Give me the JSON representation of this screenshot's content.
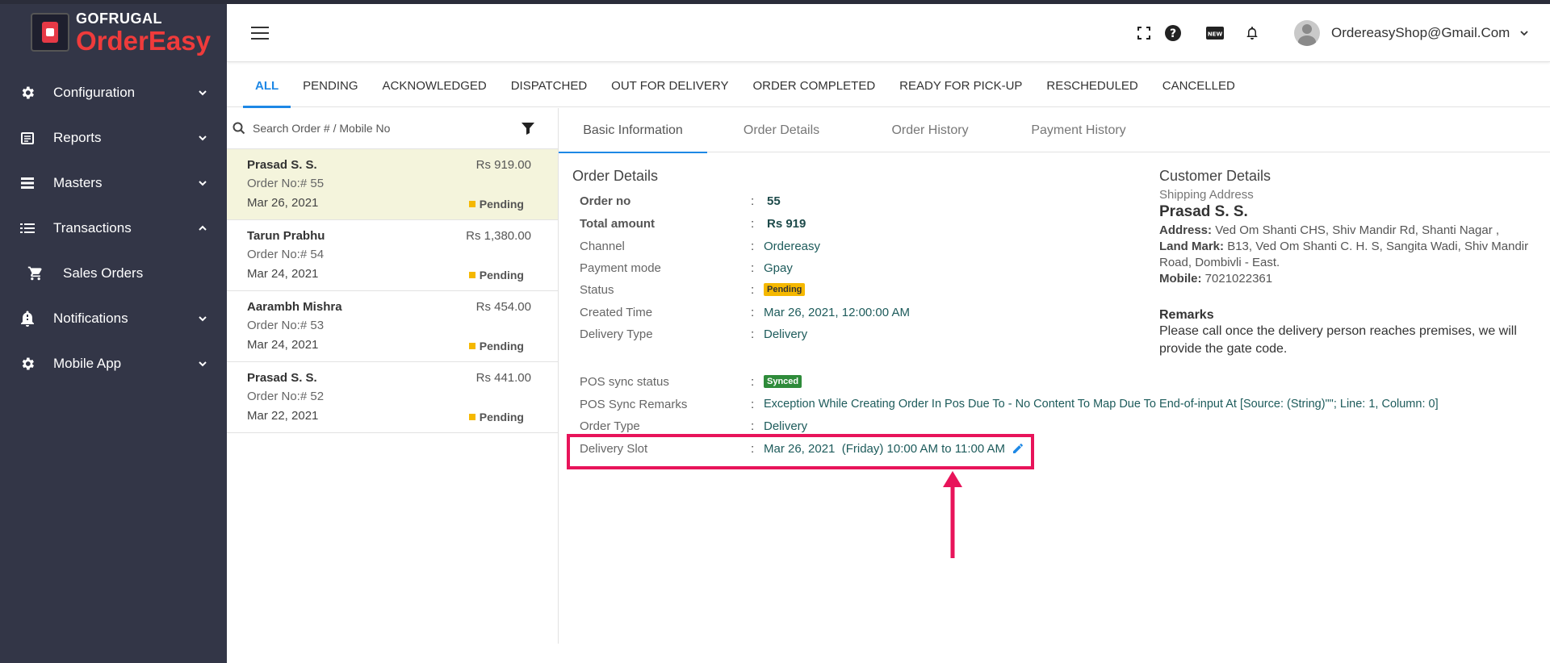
{
  "brand": {
    "top": "GOFRUGAL",
    "bottom": "OrderEasy"
  },
  "sidebar": {
    "items": [
      {
        "label": "Configuration",
        "icon": "gear-icon"
      },
      {
        "label": "Reports",
        "icon": "reports-icon"
      },
      {
        "label": "Masters",
        "icon": "masters-icon"
      },
      {
        "label": "Transactions",
        "icon": "list-icon"
      },
      {
        "label": "Sales Orders",
        "icon": "cart-icon"
      },
      {
        "label": "Notifications",
        "icon": "bell-alert-icon"
      },
      {
        "label": "Mobile App",
        "icon": "gear-icon"
      }
    ]
  },
  "header": {
    "user_email": "OrdereasyShop@Gmail.Com"
  },
  "status_tabs": [
    "ALL",
    "PENDING",
    "ACKNOWLEDGED",
    "DISPATCHED",
    "OUT FOR DELIVERY",
    "ORDER COMPLETED",
    "READY FOR PICK-UP",
    "RESCHEDULED",
    "CANCELLED"
  ],
  "search": {
    "placeholder": "Search Order # / Mobile No"
  },
  "orders": [
    {
      "name": "Prasad S. S.",
      "amount": "Rs 919.00",
      "order_no": "Order No:# 55",
      "date": "Mar 26, 2021",
      "status": "Pending"
    },
    {
      "name": "Tarun Prabhu",
      "amount": "Rs 1,380.00",
      "order_no": "Order No:# 54",
      "date": "Mar 24, 2021",
      "status": "Pending"
    },
    {
      "name": "Aarambh Mishra",
      "amount": "Rs 454.00",
      "order_no": "Order No:# 53",
      "date": "Mar 24, 2021",
      "status": "Pending"
    },
    {
      "name": "Prasad S. S.",
      "amount": "Rs 441.00",
      "order_no": "Order No:# 52",
      "date": "Mar 22, 2021",
      "status": "Pending"
    }
  ],
  "detail_tabs": [
    "Basic Information",
    "Order Details",
    "Order History",
    "Payment History"
  ],
  "order_details": {
    "title": "Order Details",
    "colon": ":",
    "fields": {
      "order_no": {
        "label": "Order no",
        "value": "55"
      },
      "total_amount": {
        "label": "Total amount",
        "value": "Rs 919"
      },
      "channel": {
        "label": "Channel",
        "value": "Ordereasy"
      },
      "payment_mode": {
        "label": "Payment mode",
        "value": "Gpay"
      },
      "status": {
        "label": "Status",
        "value": "Pending"
      },
      "created_time": {
        "label": "Created Time",
        "value": "Mar 26, 2021, 12:00:00 AM"
      },
      "delivery_type": {
        "label": "Delivery Type",
        "value": "Delivery"
      },
      "pos_sync_status": {
        "label": "POS sync status",
        "value": "Synced"
      },
      "pos_sync_remarks": {
        "label": "POS Sync Remarks",
        "value": "Exception While Creating Order In Pos Due To - No Content To Map Due To End-of-input At [Source: (String)\"\"; Line: 1, Column: 0]"
      },
      "order_type": {
        "label": "Order Type",
        "value": "Delivery"
      },
      "delivery_slot": {
        "label": "Delivery Slot",
        "value": "Mar 26, 2021  (Friday) 10:00 AM to 11:00 AM"
      }
    }
  },
  "customer": {
    "title": "Customer Details",
    "shipping_label": "Shipping Address",
    "name": "Prasad S. S.",
    "address_label": "Address:",
    "address": "Ved Om Shanti CHS, Shiv Mandir Rd, Shanti Nagar ,",
    "landmark_label": "Land Mark:",
    "landmark": "B13, Ved Om Shanti C. H. S, Sangita Wadi, Shiv Mandir Road, Dombivli - East.",
    "mobile_label": "Mobile:",
    "mobile": "7021022361",
    "remarks_title": "Remarks",
    "remarks": "Please call once the delivery person reaches premises, we will provide the gate code."
  },
  "colors": {
    "sidebar": "#333647",
    "accent": "#1e88e5",
    "pending": "#f5b800",
    "synced": "#2e8b3a",
    "annotation": "#e8145a"
  }
}
